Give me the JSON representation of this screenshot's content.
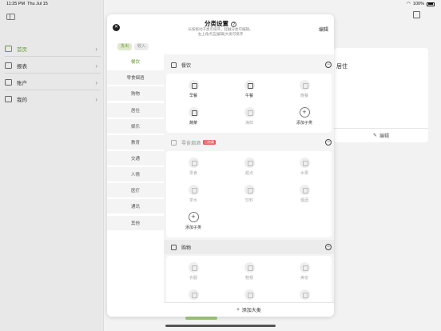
{
  "status": {
    "time": "11:25 PM",
    "date": "Thu Jul 15",
    "battery": "100%"
  },
  "sidebar": {
    "items": [
      {
        "label": "首页",
        "icon": "home-icon",
        "active": true
      },
      {
        "label": "报表",
        "icon": "chart-icon",
        "active": false
      },
      {
        "label": "账户",
        "icon": "account-icon",
        "active": false
      },
      {
        "label": "我的",
        "icon": "person-icon",
        "active": false
      }
    ]
  },
  "background": {
    "card_title": "居住",
    "card_edit": "编辑"
  },
  "modal": {
    "title": "分类设置",
    "hint_line1": "长按拖动子类可排序，轻触分类可编辑。",
    "hint_line2": "右上角点击[编辑]大类可排序",
    "edit": "编辑",
    "segment": {
      "expense": "支出",
      "income": "收入"
    },
    "categories": [
      "餐饮",
      "零食烟酒",
      "购物",
      "居住",
      "娱乐",
      "教育",
      "交通",
      "人情",
      "医疗",
      "通讯",
      "其他"
    ],
    "selected_category": "餐饮",
    "sections": {
      "food": {
        "title": "餐饮",
        "items": [
          "早餐",
          "午餐",
          "晚餐",
          "蔬菜",
          "海鲜"
        ],
        "add": "添加子类"
      },
      "snacks": {
        "title": "零食烟酒",
        "badge": "已隐藏",
        "items": [
          "零食",
          "甜点",
          "水果",
          "茶水",
          "饮料",
          "烟酒"
        ],
        "add": "添加子类"
      },
      "shopping": {
        "title": "购物",
        "items": [
          "衣服",
          "鞋帽",
          "美妆"
        ]
      }
    },
    "add_category": "添加大类"
  }
}
